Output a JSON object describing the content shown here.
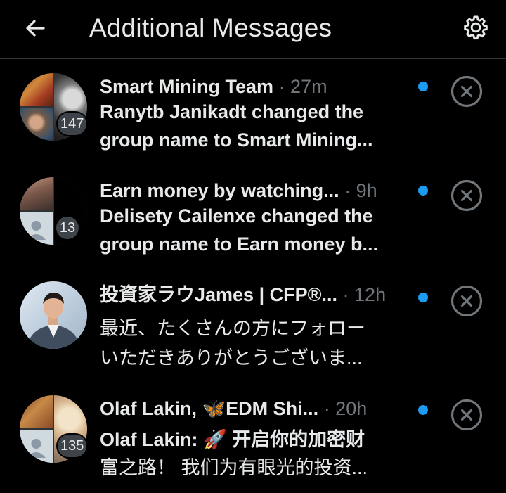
{
  "colors": {
    "background": "#000000",
    "text": "#e7e9ea",
    "muted": "#71767b",
    "unread_dot": "#1d9bf0"
  },
  "header": {
    "title": "Additional Messages",
    "back_icon": "arrow-left-icon",
    "settings_icon": "gear-icon"
  },
  "conversations": [
    {
      "name": "Smart Mining Team",
      "time": "· 27m",
      "line1": "Ranytb Janikadt changed the",
      "line2": "group name to Smart Mining...",
      "member_count": "147",
      "unread": true
    },
    {
      "name": "Earn money by watching...",
      "time": "· 9h",
      "line1": "Delisety Cailenxe changed the",
      "line2": "group name to Earn money b...",
      "member_count": "13",
      "unread": true
    },
    {
      "name": "投資家ラウJames | CFP®...",
      "time": "· 12h",
      "line1": "最近、たくさんの方にフォロー",
      "line2": "いただきありがとうございま...",
      "member_count": "",
      "unread": true
    },
    {
      "name": "Olaf Lakin, 🦋EDM Shi...",
      "time": "· 20h",
      "line1": "Olaf Lakin: 🚀 开启你的加密财",
      "line2": "富之路！ 我们为有眼光的投资...",
      "member_count": "135",
      "unread": true
    }
  ]
}
